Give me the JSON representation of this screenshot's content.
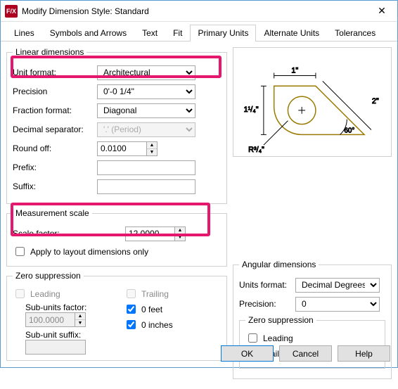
{
  "window": {
    "title": "Modify Dimension Style: Standard",
    "app_icon_text": "F/X"
  },
  "tabs": [
    "Lines",
    "Symbols and Arrows",
    "Text",
    "Fit",
    "Primary Units",
    "Alternate Units",
    "Tolerances"
  ],
  "active_tab": 4,
  "linear": {
    "legend": "Linear dimensions",
    "unit_format_label": "Unit format:",
    "unit_format_value": "Architectural",
    "precision_label": "Precision",
    "precision_value": "0'-0 1/4\"",
    "fraction_format_label": "Fraction format:",
    "fraction_format_value": "Diagonal",
    "decimal_sep_label": "Decimal separator:",
    "decimal_sep_value": "'.' (Period)",
    "round_off_label": "Round off:",
    "round_off_value": "0.0100",
    "prefix_label": "Prefix:",
    "prefix_value": "",
    "suffix_label": "Suffix:",
    "suffix_value": ""
  },
  "measurement": {
    "legend": "Measurement scale",
    "scale_factor_label": "Scale factor:",
    "scale_factor_value": "12.0000",
    "apply_layout_label": "Apply to layout dimensions only"
  },
  "zero_left": {
    "legend": "Zero suppression",
    "leading_label": "Leading",
    "trailing_label": "Trailing",
    "sub_units_factor_label": "Sub-units factor:",
    "sub_units_factor_value": "100.0000",
    "sub_unit_suffix_label": "Sub-unit suffix:",
    "sub_unit_suffix_value": "",
    "zero_feet_label": "0 feet",
    "zero_inches_label": "0 inches"
  },
  "angular": {
    "legend": "Angular dimensions",
    "units_format_label": "Units format:",
    "units_format_value": "Decimal Degrees",
    "precision_label": "Precision:",
    "precision_value": "0"
  },
  "zero_right": {
    "legend": "Zero suppression",
    "leading_label": "Leading",
    "trailing_label": "Trailing"
  },
  "preview": {
    "dim1": "1\"",
    "dim2": "1¹/₄\"",
    "dim3": "2\"",
    "angle": "60°",
    "radius": "R³/₄\""
  },
  "buttons": {
    "ok": "OK",
    "cancel": "Cancel",
    "help": "Help"
  }
}
